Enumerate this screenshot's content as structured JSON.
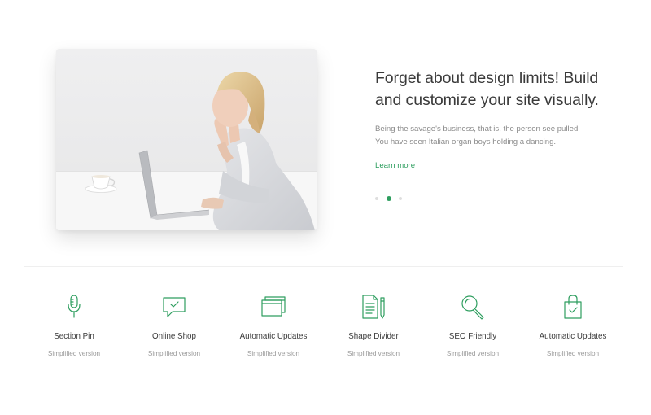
{
  "hero": {
    "title_lines": [
      "Forget about design limits! Build",
      "and customize your site visually."
    ],
    "text_lines": [
      "Being the savage's business, that is, the person see pulled",
      "You have seen Italian organ boys holding a dancing."
    ],
    "learn_more": "Learn more",
    "slides": {
      "count": 3,
      "active": 2
    },
    "accent_color": "#2e9e5f"
  },
  "features": [
    {
      "icon": "microphone-icon",
      "title": "Section Pin",
      "subtitle": "Simplified version"
    },
    {
      "icon": "chat-check-icon",
      "title": "Online Shop",
      "subtitle": "Simplified version"
    },
    {
      "icon": "windows-icon",
      "title": "Automatic Updates",
      "subtitle": "Simplified version"
    },
    {
      "icon": "document-pen-icon",
      "title": "Shape Divider",
      "subtitle": "Simplified version"
    },
    {
      "icon": "magnifier-icon",
      "title": "SEO Friendly",
      "subtitle": "Simplified version"
    },
    {
      "icon": "shopping-bag-check-icon",
      "title": "Automatic Updates",
      "subtitle": "Simplified version"
    }
  ]
}
